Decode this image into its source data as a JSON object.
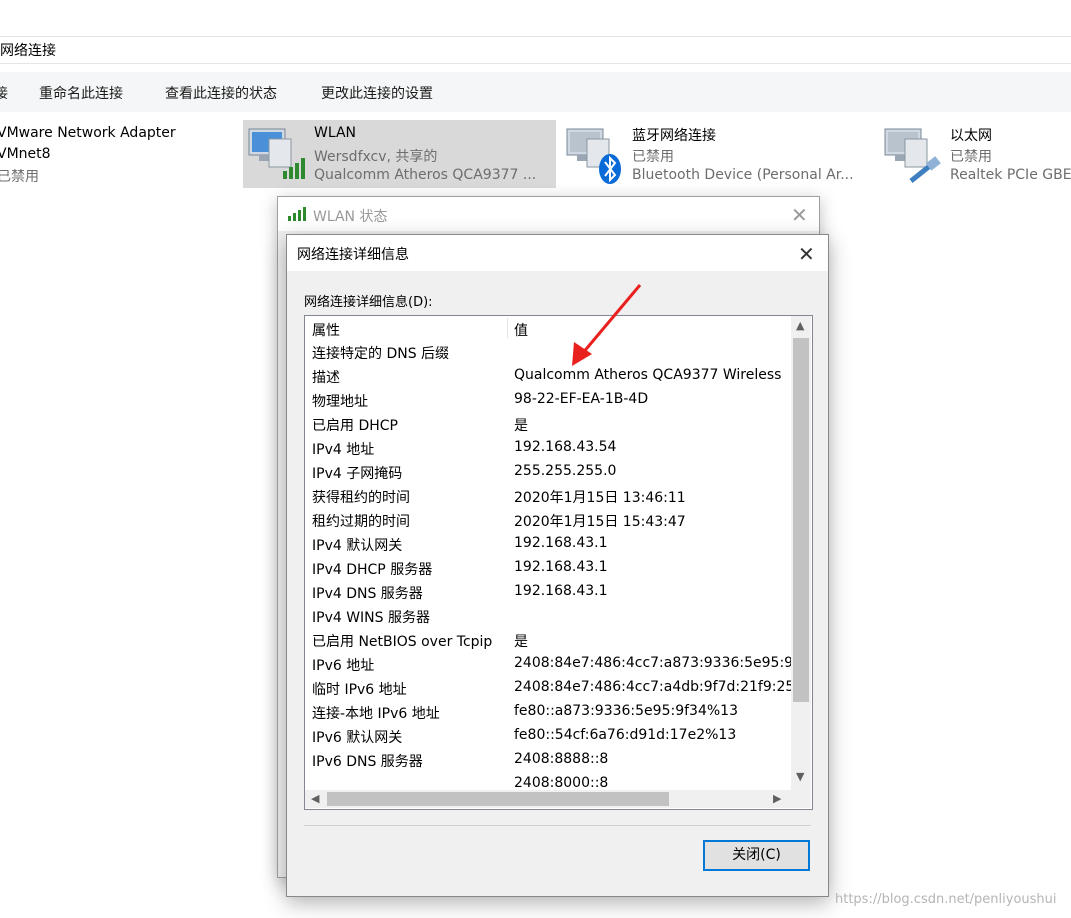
{
  "address": {
    "path": "网络连接"
  },
  "commands": [
    "接",
    "重命名此连接",
    "查看此连接的状态",
    "更改此连接的设置"
  ],
  "connections": [
    {
      "name": "VMware Network Adapter",
      "name2": "VMnet8",
      "status": "已禁用",
      "icon": "network-adapter-icon"
    },
    {
      "name": "WLAN",
      "status": "Wersdfxcv, 共享的",
      "device": "Qualcomm Atheros QCA9377 ...",
      "icon": "wifi-signal-icon"
    },
    {
      "name": "蓝牙网络连接",
      "status": "已禁用",
      "device": "Bluetooth Device (Personal Ar...",
      "icon": "bluetooth-icon"
    },
    {
      "name": "以太网",
      "status": "已禁用",
      "device": "Realtek PCIe GBE",
      "icon": "ethernet-icon"
    }
  ],
  "status_dialog": {
    "title": "WLAN 状态"
  },
  "details_dialog": {
    "title": "网络连接详细信息",
    "label": "网络连接详细信息(D):",
    "columns": [
      "属性",
      "值"
    ],
    "rows": [
      {
        "key": "连接特定的 DNS 后缀",
        "value": ""
      },
      {
        "key": "描述",
        "value": "Qualcomm Atheros QCA9377 Wireless"
      },
      {
        "key": "物理地址",
        "value": "98-22-EF-EA-1B-4D"
      },
      {
        "key": "已启用 DHCP",
        "value": "是"
      },
      {
        "key": "IPv4 地址",
        "value": "192.168.43.54"
      },
      {
        "key": "IPv4 子网掩码",
        "value": "255.255.255.0"
      },
      {
        "key": "获得租约的时间",
        "value": "2020年1月15日 13:46:11"
      },
      {
        "key": "租约过期的时间",
        "value": "2020年1月15日 15:43:47"
      },
      {
        "key": "IPv4 默认网关",
        "value": "192.168.43.1"
      },
      {
        "key": "IPv4 DHCP 服务器",
        "value": "192.168.43.1"
      },
      {
        "key": "IPv4 DNS 服务器",
        "value": "192.168.43.1"
      },
      {
        "key": "IPv4 WINS 服务器",
        "value": ""
      },
      {
        "key": "已启用 NetBIOS over Tcpip",
        "value": "是"
      },
      {
        "key": "IPv6 地址",
        "value": "2408:84e7:486:4cc7:a873:9336:5e95:9"
      },
      {
        "key": "临时 IPv6 地址",
        "value": "2408:84e7:486:4cc7:a4db:9f7d:21f9:25"
      },
      {
        "key": "连接-本地 IPv6 地址",
        "value": "fe80::a873:9336:5e95:9f34%13"
      },
      {
        "key": "IPv6 默认网关",
        "value": "fe80::54cf:6a76:d91d:17e2%13"
      },
      {
        "key": "IPv6 DNS 服务器",
        "value": "2408:8888::8"
      },
      {
        "key": "",
        "value": "2408:8000::8"
      }
    ],
    "close_button": "关闭(C)"
  },
  "watermark": "https://blog.csdn.net/penliyoushui",
  "colors": {
    "accent": "#0078d7",
    "annotation_arrow": "#e8201e",
    "selected_tile": "#d9d9d9"
  }
}
